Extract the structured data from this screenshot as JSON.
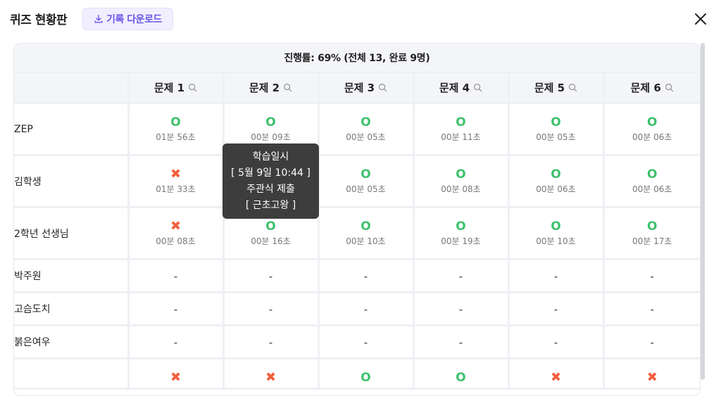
{
  "header": {
    "title": "퀴즈 현황판",
    "download_label": "기록 다운로드",
    "download_icon": "download-icon",
    "close_icon": "close-icon"
  },
  "progress": "진행률: 69% (전체 13, 완료 9명)",
  "columns": [
    "문제 1",
    "문제 2",
    "문제 3",
    "문제 4",
    "문제 5",
    "문제 6"
  ],
  "rows": [
    {
      "name": "ZEP",
      "cells": [
        {
          "mark": "O",
          "time": "01분 56초"
        },
        {
          "mark": "O",
          "time": "00분 09초"
        },
        {
          "mark": "O",
          "time": "00분 05초"
        },
        {
          "mark": "O",
          "time": "00분 11초"
        },
        {
          "mark": "O",
          "time": "00분 05초"
        },
        {
          "mark": "O",
          "time": "00분 06초"
        }
      ]
    },
    {
      "name": "김학생",
      "cells": [
        {
          "mark": "✖",
          "time": "01분 33초"
        },
        {
          "mark": "",
          "time": ""
        },
        {
          "mark": "O",
          "time": "00분 05초"
        },
        {
          "mark": "O",
          "time": "00분 08초"
        },
        {
          "mark": "O",
          "time": "00분 06초"
        },
        {
          "mark": "O",
          "time": "00분 06초"
        }
      ]
    },
    {
      "name": "2학년 선생님",
      "cells": [
        {
          "mark": "✖",
          "time": "00분 08초"
        },
        {
          "mark": "O",
          "time": "00분 16초"
        },
        {
          "mark": "O",
          "time": "00분 10초"
        },
        {
          "mark": "O",
          "time": "00분 19초"
        },
        {
          "mark": "O",
          "time": "00분 10초"
        },
        {
          "mark": "O",
          "time": "00분 17초"
        }
      ]
    },
    {
      "name": "박주원",
      "cells": [
        "-",
        "-",
        "-",
        "-",
        "-",
        "-"
      ]
    },
    {
      "name": "고슴도치",
      "cells": [
        "-",
        "-",
        "-",
        "-",
        "-",
        "-"
      ]
    },
    {
      "name": "붉은여우",
      "cells": [
        "-",
        "-",
        "-",
        "-",
        "-",
        "-"
      ]
    },
    {
      "name": "",
      "cells": [
        "✖",
        "✖",
        "O",
        "O",
        "✖",
        "✖"
      ]
    }
  ],
  "tooltip": {
    "line1": "학습일시",
    "line2": "[ 5월 9일 10:44 ]",
    "line3": "주관식 제출",
    "line4": "[ 근초고왕 ]"
  },
  "colors": {
    "correct": "#3ec16b",
    "wrong": "#f2603d",
    "accent": "#6a56e6"
  }
}
